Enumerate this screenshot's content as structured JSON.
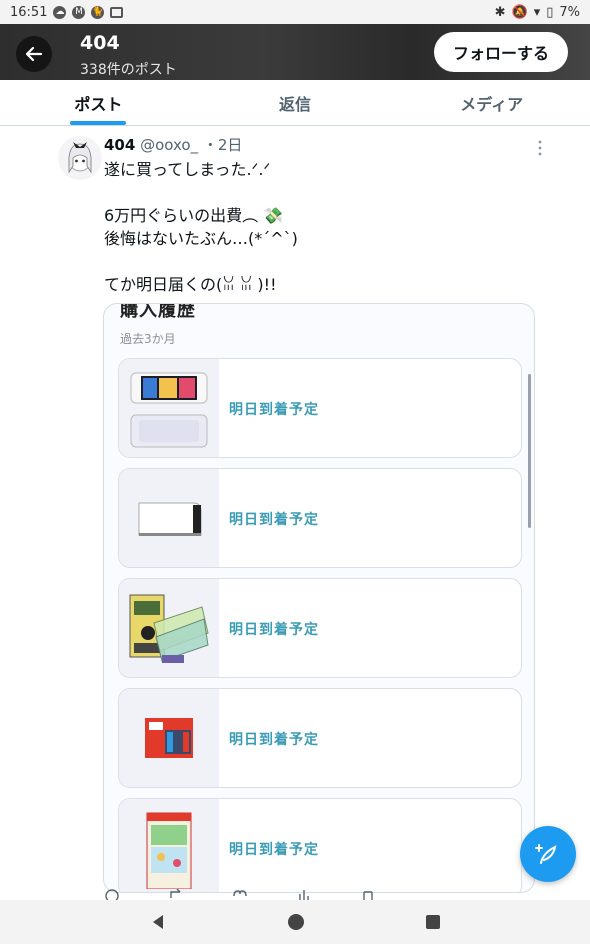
{
  "status_bar": {
    "time": "16:51",
    "battery": "7%"
  },
  "header": {
    "title": "404",
    "subtitle": "338件のポスト",
    "follow_label": "フォローする",
    "back_icon": "arrow-left-icon",
    "bg_color": "#333333"
  },
  "tabs": [
    {
      "label": "ポスト",
      "active": true
    },
    {
      "label": "返信",
      "active": false
    },
    {
      "label": "メディア",
      "active": false
    }
  ],
  "post": {
    "name": "404",
    "handle": "@ooxo_",
    "time": "・2日",
    "text": "遂に買ってしまった.ᐟ.ᐟ\n\n6万円ぐらいの出費︵ 💸\n後悔はないたぶん…(*´^`)\n\nてか明日届くの(ꈍ ꈍ )!!"
  },
  "media": {
    "title": "購入履歴",
    "subtitle": "過去3か月",
    "orders": [
      {
        "status": "明日到着予定",
        "item": "switch-oled-console"
      },
      {
        "status": "明日到着予定",
        "item": "switch-dock"
      },
      {
        "status": "明日到着予定",
        "item": "screen-protector-pack"
      },
      {
        "status": "明日到着予定",
        "item": "switch-box"
      },
      {
        "status": "明日到着予定",
        "item": "game-package"
      }
    ]
  },
  "colors": {
    "accent": "#1d9bf0",
    "status_text": "#3a9bb5"
  }
}
